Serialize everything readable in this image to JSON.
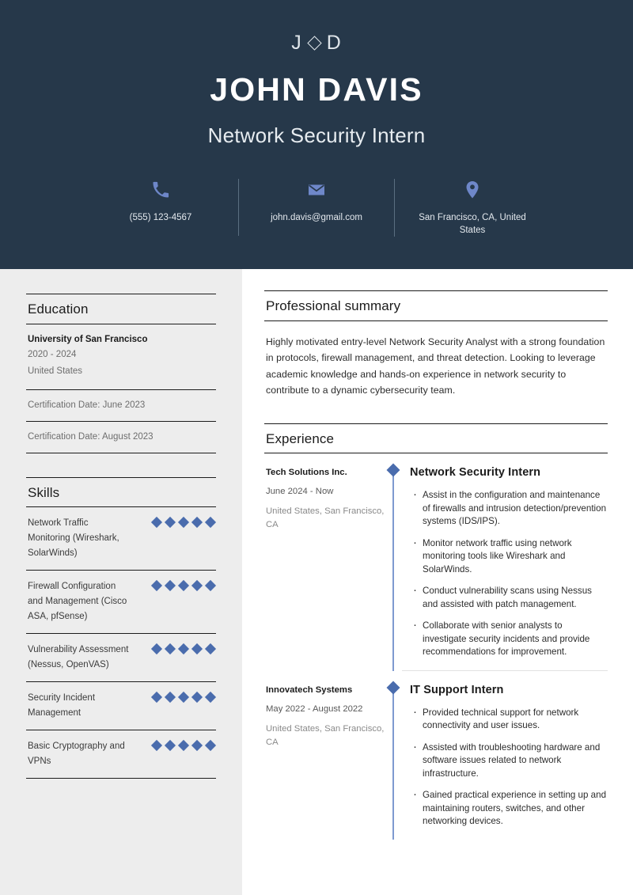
{
  "theme": {
    "header_bg": "#26384a",
    "sidebar_bg": "#ededed",
    "main_bg": "#ffffff",
    "accent_blue": "#4a6cad",
    "icon_blue": "#6e87c9",
    "timeline_blue": "#7e9ad0",
    "rule_dark": "#1b1b1b"
  },
  "header": {
    "monogram_left": "J",
    "monogram_icon": "diamond-outline-icon",
    "monogram_right": "D",
    "name": "JOHN DAVIS",
    "job_title": "Network Security Intern",
    "contacts": [
      {
        "icon": "phone-icon",
        "text": "(555) 123-4567"
      },
      {
        "icon": "envelope-icon",
        "text": "john.davis@gmail.com"
      },
      {
        "icon": "location-pin-icon",
        "text": "San Francisco, CA, United States"
      }
    ]
  },
  "sidebar": {
    "education": {
      "heading": "Education",
      "items": [
        {
          "school": "University of San Francisco",
          "dates": "2020 - 2024",
          "location": "United States"
        }
      ],
      "certifications": [
        {
          "text": "Certification Date: June 2023"
        },
        {
          "text": "Certification Date: August 2023"
        }
      ]
    },
    "skills": {
      "heading": "Skills",
      "items": [
        {
          "label": "Network Traffic Monitoring (Wireshark, SolarWinds)",
          "rating": 5,
          "max": 5
        },
        {
          "label": "Firewall Configuration and Management (Cisco ASA, pfSense)",
          "rating": 5,
          "max": 5
        },
        {
          "label": "Vulnerability Assessment (Nessus, OpenVAS)",
          "rating": 5,
          "max": 5
        },
        {
          "label": "Security Incident Management",
          "rating": 5,
          "max": 5
        },
        {
          "label": "Basic Cryptography and VPNs",
          "rating": 5,
          "max": 5
        }
      ]
    }
  },
  "main": {
    "summary": {
      "heading": "Professional summary",
      "text": "Highly motivated entry-level Network Security Analyst with a strong foundation in protocols, firewall management, and threat detection. Looking to leverage academic knowledge and hands-on experience in network security to contribute to a dynamic cybersecurity team."
    },
    "experience": {
      "heading": "Experience",
      "items": [
        {
          "company": "Tech Solutions Inc.",
          "dates": "June 2024 - Now",
          "location": "United States, San Francisco, CA",
          "role": "Network Security Intern",
          "bullets": [
            "Assist in the configuration and maintenance of firewalls and intrusion detection/prevention systems (IDS/IPS).",
            "Monitor network traffic using network monitoring tools like Wireshark and SolarWinds.",
            "Conduct vulnerability scans using Nessus and assisted with patch management.",
            "Collaborate with senior analysts to investigate security incidents and provide recommendations for improvement."
          ]
        },
        {
          "company": "Innovatech Systems",
          "dates": "May 2022 - August 2022",
          "location": "United States, San Francisco, CA",
          "role": "IT Support Intern",
          "bullets": [
            "Provided technical support for network connectivity and user issues.",
            "Assisted with troubleshooting hardware and software issues related to network infrastructure.",
            "Gained practical experience in setting up and maintaining routers, switches, and other networking devices."
          ]
        }
      ]
    }
  }
}
